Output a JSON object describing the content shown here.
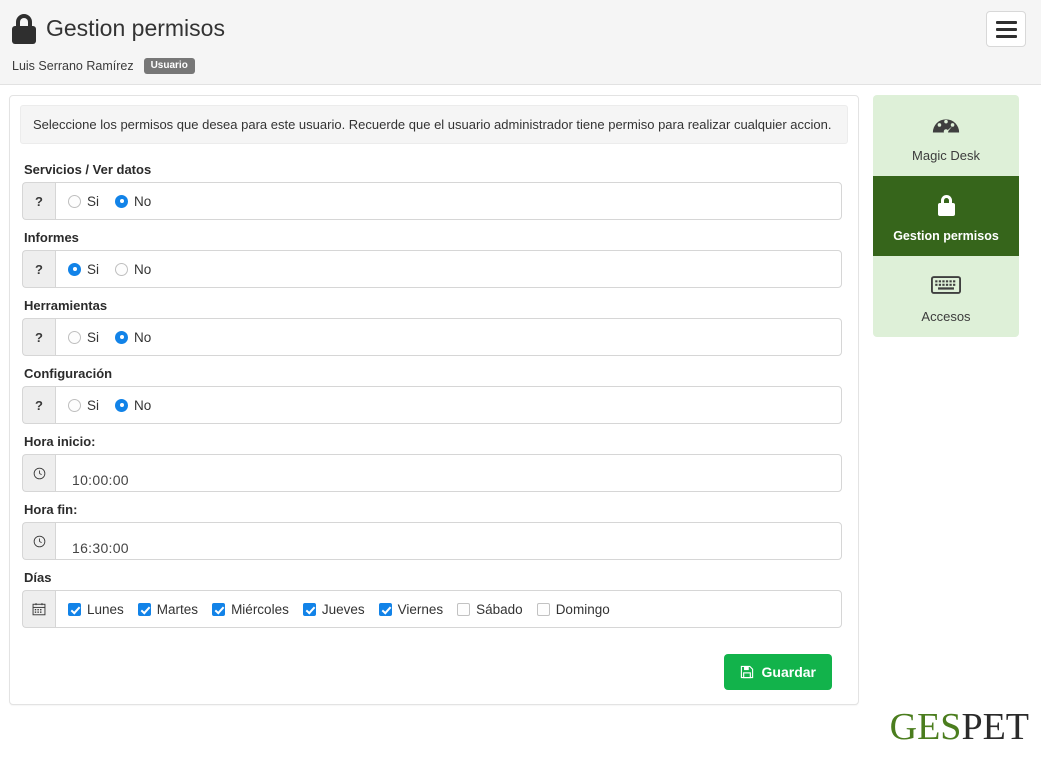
{
  "header": {
    "title": "Gestion permisos",
    "lock_icon": "lock-icon",
    "user_name": "Luis Serrano Ramírez",
    "badge": "Usuario",
    "menu_icon": "hamburger-menu-icon"
  },
  "alert": {
    "text": "Seleccione los permisos que desea para este usuario. Recuerde que el usuario administrador tiene permiso para realizar cualquier accion."
  },
  "form": {
    "addon_help": "?",
    "permissions": [
      {
        "label": "Servicios / Ver datos",
        "options": [
          "Si",
          "No"
        ],
        "selected": "No"
      },
      {
        "label": "Informes",
        "options": [
          "Si",
          "No"
        ],
        "selected": "Si"
      },
      {
        "label": "Herramientas",
        "options": [
          "Si",
          "No"
        ],
        "selected": "No"
      },
      {
        "label": "Configuración",
        "options": [
          "Si",
          "No"
        ],
        "selected": "No"
      }
    ],
    "hora_inicio": {
      "label": "Hora inicio:",
      "value": "10:00:00",
      "icon": "clock-icon"
    },
    "hora_fin": {
      "label": "Hora fin:",
      "value": "16:30:00",
      "icon": "clock-icon"
    },
    "dias": {
      "label": "Días",
      "icon": "calendar-icon",
      "days": [
        {
          "label": "Lunes",
          "checked": true
        },
        {
          "label": "Martes",
          "checked": true
        },
        {
          "label": "Miércoles",
          "checked": true
        },
        {
          "label": "Jueves",
          "checked": true
        },
        {
          "label": "Viernes",
          "checked": true
        },
        {
          "label": "Sábado",
          "checked": false
        },
        {
          "label": "Domingo",
          "checked": false
        }
      ]
    },
    "save_label": "Guardar",
    "save_icon": "floppy-disk-icon"
  },
  "sidebar": {
    "items": [
      {
        "label": "Magic Desk",
        "icon": "dashboard-gauge-icon",
        "active": false
      },
      {
        "label": "Gestion permisos",
        "icon": "lock-icon",
        "active": true
      },
      {
        "label": "Accesos",
        "icon": "keyboard-icon",
        "active": false
      }
    ]
  },
  "logo": {
    "part1": "GES",
    "part2": "PET"
  },
  "colors": {
    "accent_green": "#12b34b",
    "sidebar_active": "#36651b",
    "sidebar_bg": "#def0d8",
    "radio_blue": "#1283e8",
    "badge_gray": "#777777"
  }
}
